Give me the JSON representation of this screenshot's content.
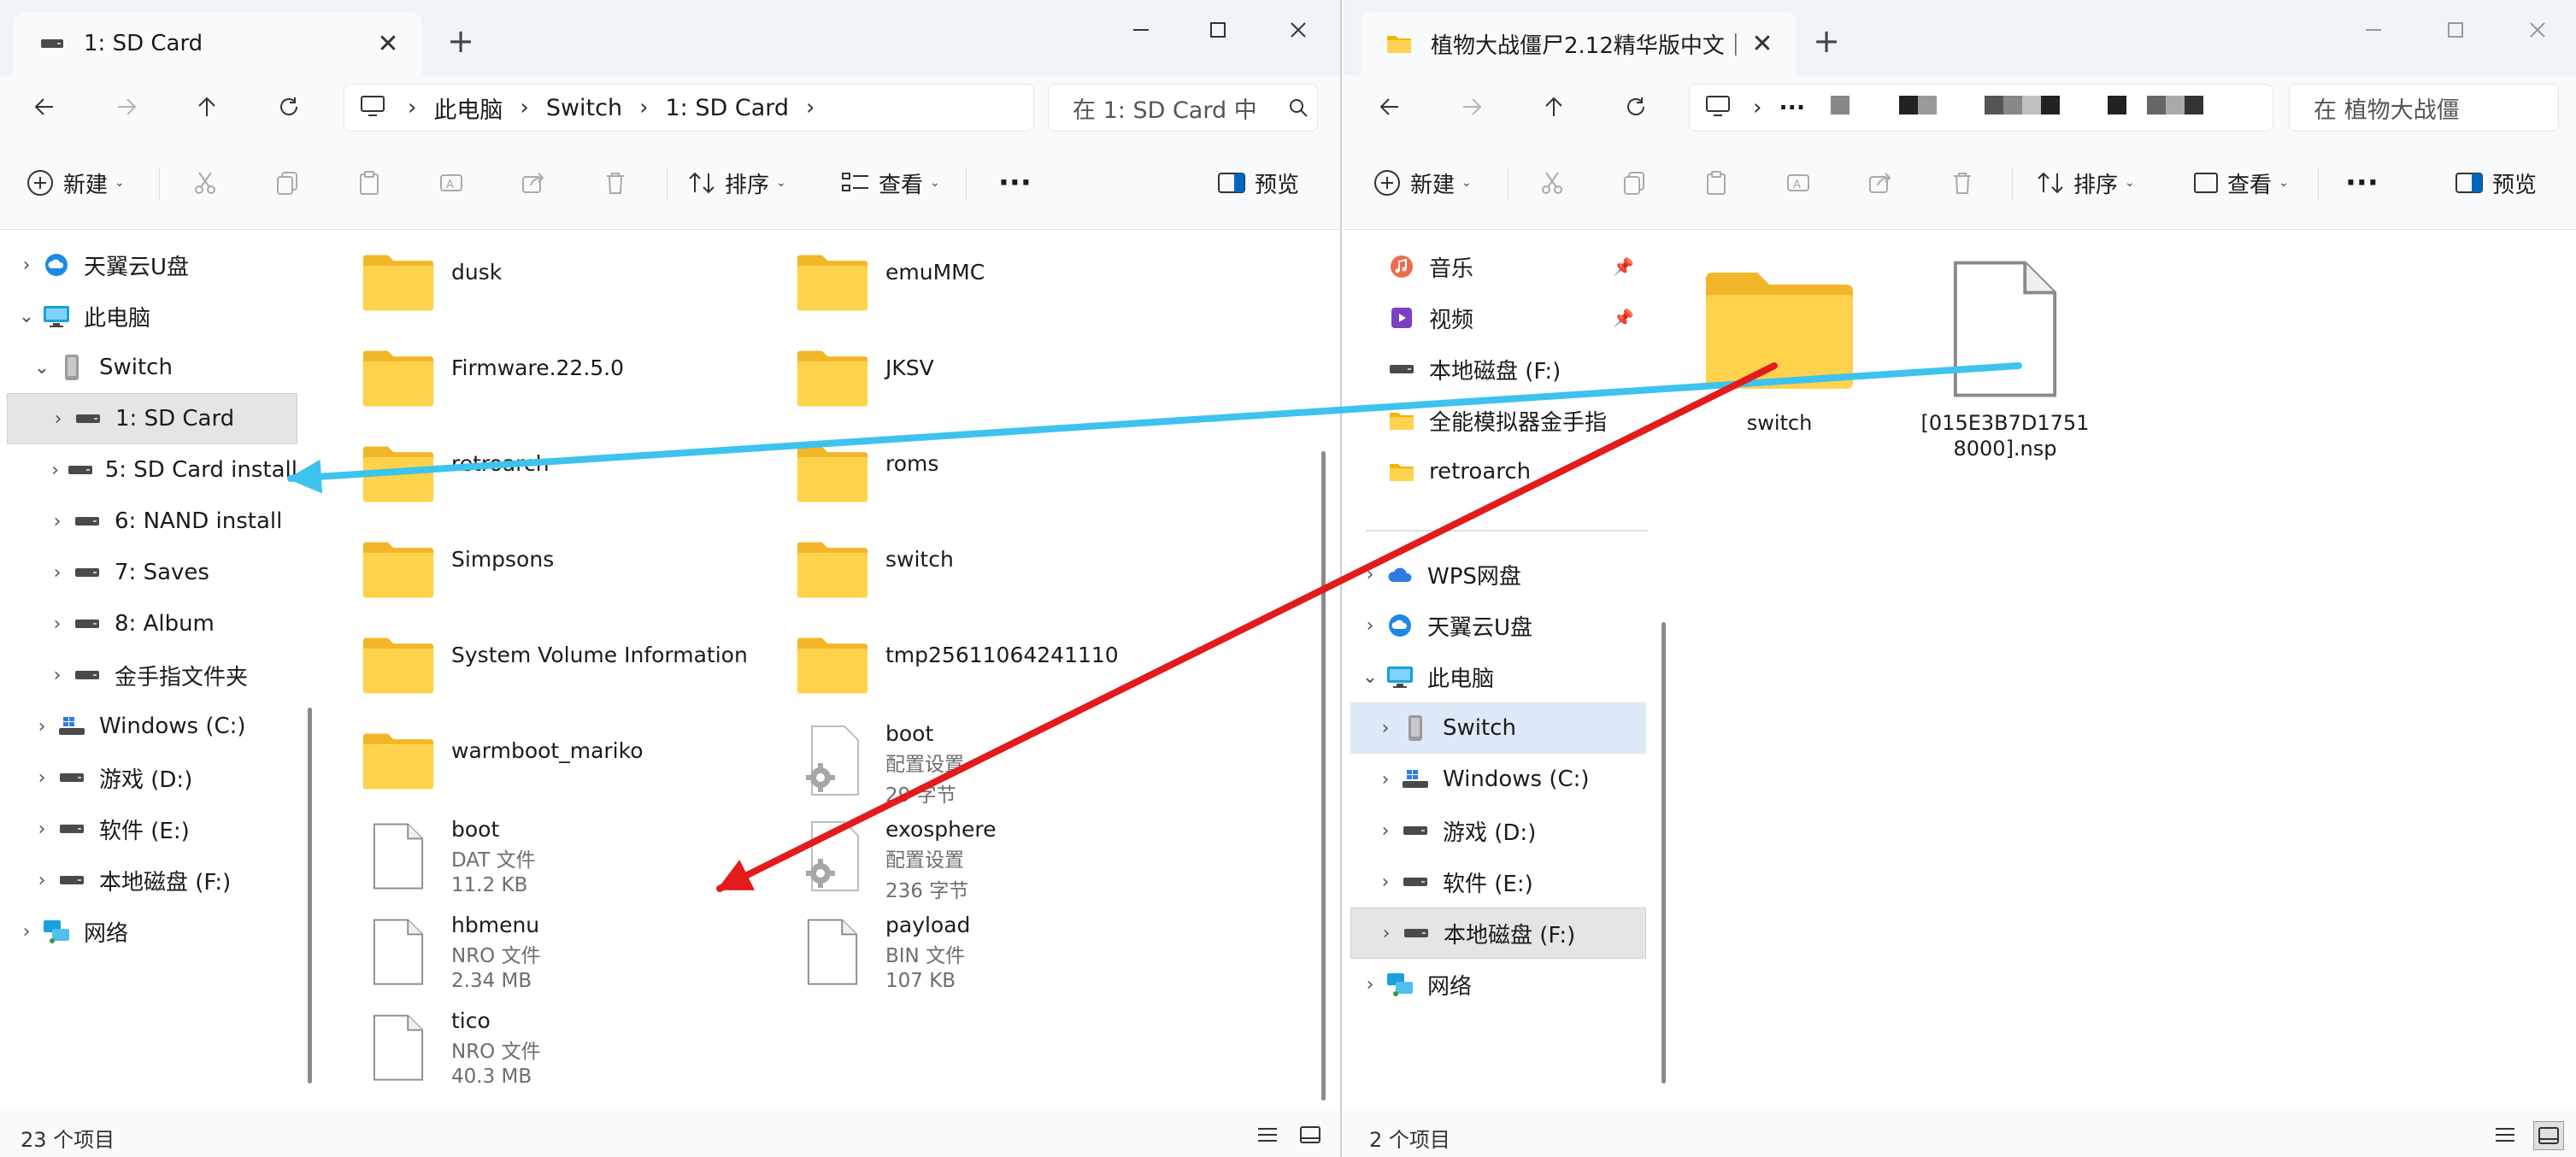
{
  "left": {
    "tab_title": "1: SD Card",
    "breadcrumbs": [
      "此电脑",
      "Switch",
      "1: SD Card"
    ],
    "search_placeholder": "在 1: SD Card 中",
    "toolbar": {
      "new": "新建",
      "sort": "排序",
      "view": "查看",
      "more": "···",
      "preview": "预览"
    },
    "nav": [
      {
        "label": "天翼云U盘",
        "icon": "cloud-drive-icon"
      },
      {
        "label": "此电脑",
        "icon": "pc-icon"
      },
      {
        "label": "Switch",
        "icon": "device-icon"
      },
      {
        "label": "1: SD Card",
        "icon": "drive-icon"
      },
      {
        "label": "5: SD Card install",
        "icon": "drive-icon"
      },
      {
        "label": "6: NAND install",
        "icon": "drive-icon"
      },
      {
        "label": "7: Saves",
        "icon": "drive-icon"
      },
      {
        "label": "8: Album",
        "icon": "drive-icon"
      },
      {
        "label": "金手指文件夹",
        "icon": "drive-icon"
      },
      {
        "label": "Windows (C:)",
        "icon": "windows-drive-icon"
      },
      {
        "label": "游戏 (D:)",
        "icon": "drive-icon"
      },
      {
        "label": "软件 (E:)",
        "icon": "drive-icon"
      },
      {
        "label": "本地磁盘 (F:)",
        "icon": "drive-icon"
      },
      {
        "label": "网络",
        "icon": "network-icon"
      }
    ],
    "files": [
      {
        "name": "dusk",
        "type": "folder"
      },
      {
        "name": "emuMMC",
        "type": "folder"
      },
      {
        "name": "Firmware.22.5.0",
        "type": "folder"
      },
      {
        "name": "JKSV",
        "type": "folder"
      },
      {
        "name": "retroarch",
        "type": "folder"
      },
      {
        "name": "roms",
        "type": "folder"
      },
      {
        "name": "Simpsons",
        "type": "folder"
      },
      {
        "name": "switch",
        "type": "folder"
      },
      {
        "name": "System Volume Information",
        "type": "folder"
      },
      {
        "name": "tmp25611064241110",
        "type": "folder"
      },
      {
        "name": "warmboot_mariko",
        "type": "folder"
      },
      {
        "name": "boot",
        "type": "config",
        "kind": "配置设置",
        "size": "29 字节"
      },
      {
        "name": "boot",
        "type": "file",
        "kind": "DAT 文件",
        "size": "11.2 KB"
      },
      {
        "name": "exosphere",
        "type": "config",
        "kind": "配置设置",
        "size": "236 字节"
      },
      {
        "name": "hbmenu",
        "type": "file",
        "kind": "NRO 文件",
        "size": "2.34 MB"
      },
      {
        "name": "payload",
        "type": "file",
        "kind": "BIN 文件",
        "size": "107 KB"
      },
      {
        "name": "tico",
        "type": "file",
        "kind": "NRO 文件",
        "size": "40.3 MB"
      }
    ],
    "status": "23 个项目"
  },
  "right": {
    "tab_title": "植物大战僵尸2.12精华版中文｜",
    "search_placeholder": "在 植物大战僵",
    "breadcrumb_more": "···",
    "toolbar": {
      "new": "新建",
      "sort": "排序",
      "view": "查看",
      "more": "···",
      "preview": "预览"
    },
    "nav": [
      {
        "label": "音乐",
        "icon": "music-icon",
        "pinned": true
      },
      {
        "label": "视频",
        "icon": "video-icon",
        "pinned": true
      },
      {
        "label": "本地磁盘 (F:)",
        "icon": "drive-icon"
      },
      {
        "label": "全能模拟器金手指",
        "icon": "folder-icon"
      },
      {
        "label": "retroarch",
        "icon": "folder-icon"
      },
      {
        "label": "WPS网盘",
        "icon": "wps-cloud-icon"
      },
      {
        "label": "天翼云U盘",
        "icon": "cloud-drive-icon"
      },
      {
        "label": "此电脑",
        "icon": "pc-icon"
      },
      {
        "label": "Switch",
        "icon": "device-icon"
      },
      {
        "label": "Windows (C:)",
        "icon": "windows-drive-icon"
      },
      {
        "label": "游戏 (D:)",
        "icon": "drive-icon"
      },
      {
        "label": "软件 (E:)",
        "icon": "drive-icon"
      },
      {
        "label": "本地磁盘 (F:)",
        "icon": "drive-icon"
      },
      {
        "label": "网络",
        "icon": "network-icon"
      }
    ],
    "items": [
      {
        "name": "switch",
        "type": "folder"
      },
      {
        "name": "[015E3B7D1751 8000].nsp",
        "line1": "[015E3B7D1751",
        "line2": "8000].nsp",
        "type": "file"
      }
    ],
    "status": "2 个项目"
  },
  "colors": {
    "arrow_blue": "#3cc3ee",
    "arrow_red": "#e31b1b",
    "folder": "#ffcf48",
    "selection": "#dde9f6"
  }
}
